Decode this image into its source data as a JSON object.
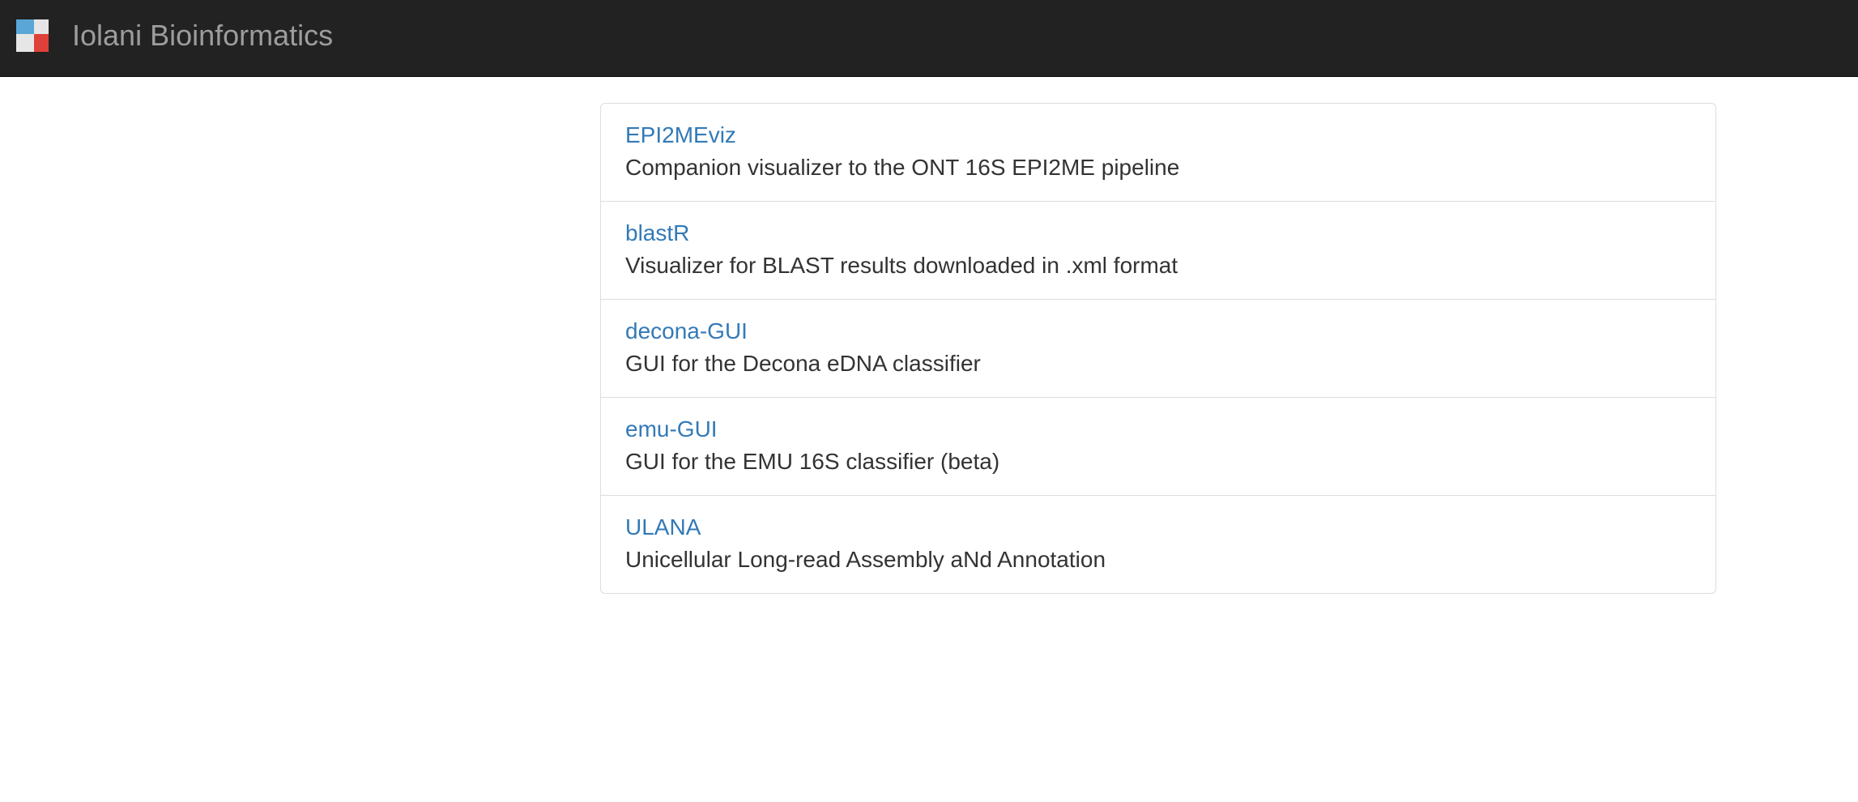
{
  "header": {
    "brand": "Iolani Bioinformatics",
    "logo_icon": "logo-icon",
    "colors": {
      "background": "#222222",
      "brand_text": "#9d9d9d",
      "logo_blue": "#5aa6d6",
      "logo_red": "#e0403a",
      "logo_gray": "#e6e6e6"
    }
  },
  "apps": {
    "items": [
      {
        "title": "EPI2MEviz",
        "description": "Companion visualizer to the ONT 16S EPI2ME pipeline"
      },
      {
        "title": "blastR",
        "description": "Visualizer for BLAST results downloaded in .xml format"
      },
      {
        "title": "decona-GUI",
        "description": "GUI for the Decona eDNA classifier"
      },
      {
        "title": "emu-GUI",
        "description": "GUI for the EMU 16S classifier (beta)"
      },
      {
        "title": "ULANA",
        "description": "Unicellular Long-read Assembly aNd Annotation"
      }
    ],
    "colors": {
      "link": "#337ab7",
      "text": "#333333",
      "border": "#dddddd"
    }
  }
}
